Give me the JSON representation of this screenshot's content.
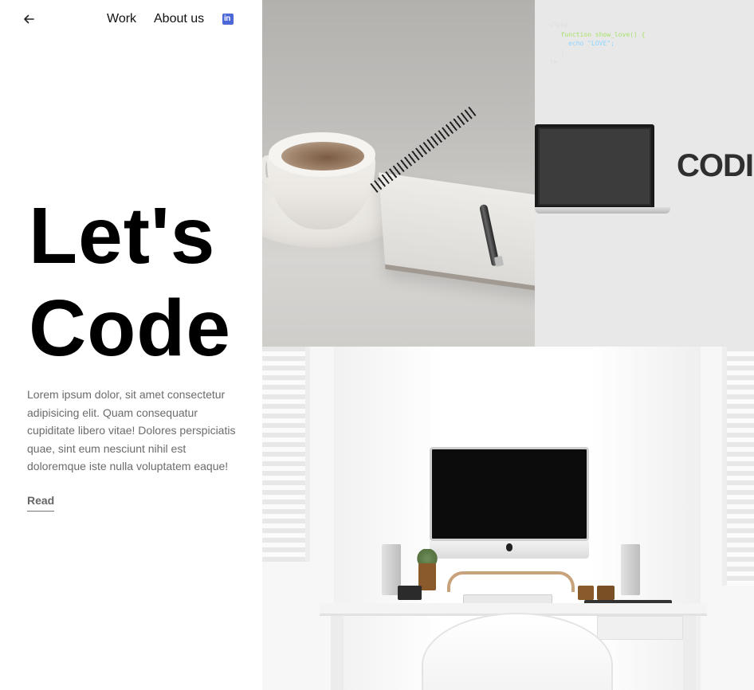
{
  "nav": {
    "back_icon": "arrow-left-icon",
    "links": [
      "Work",
      "About us"
    ],
    "social_icon": "linkedin-icon",
    "social_text": "in"
  },
  "hero": {
    "line1": "Let's",
    "line2": "Code"
  },
  "description": "Lorem ipsum dolor, sit amet consectetur adipisicing elit. Quam consequatur cupiditate libero vitae! Dolores perspiciatis quae, sint eum nesciunt nihil est doloremque iste nulla voluptatem eaque!",
  "read_label": "Read",
  "images": {
    "top_left": "coffee-notebook-photo",
    "top_right": "coding-laptop-photo",
    "bottom": "desk-workspace-photo",
    "code_lines": [
      "<?php",
      "function show_love() {",
      "echo \"LOVE\";",
      "}",
      "?>"
    ],
    "coding_word": "CODI"
  },
  "colors": {
    "linkedin": "#4c68d7",
    "text": "#111111",
    "muted": "#6b6b6b"
  }
}
